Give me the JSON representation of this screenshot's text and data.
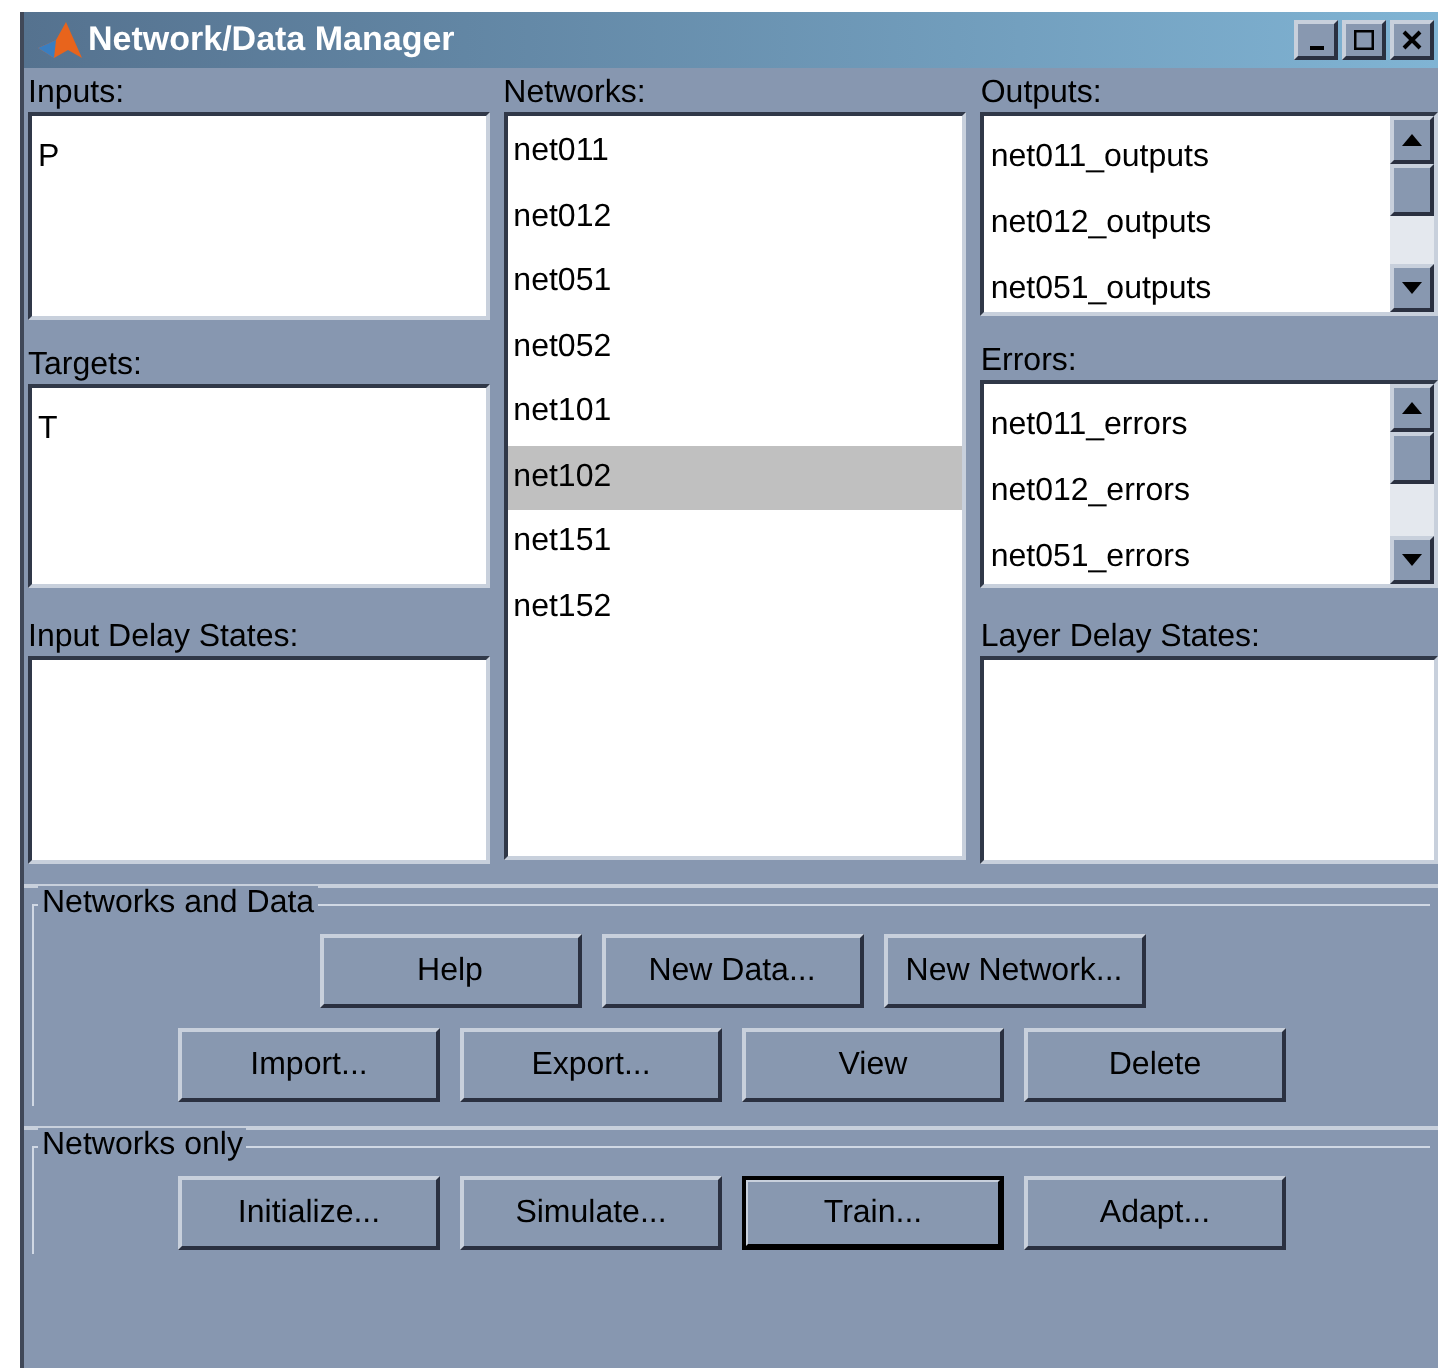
{
  "window": {
    "title": "Network/Data Manager"
  },
  "inputs": {
    "label": "Inputs:",
    "items": [
      "P"
    ]
  },
  "targets": {
    "label": "Targets:",
    "items": [
      "T"
    ]
  },
  "input_delay_states": {
    "label": "Input Delay States:"
  },
  "networks": {
    "label": "Networks:",
    "items": [
      {
        "name": "net011",
        "selected": false
      },
      {
        "name": "net012",
        "selected": false
      },
      {
        "name": "net051",
        "selected": false
      },
      {
        "name": "net052",
        "selected": false
      },
      {
        "name": "net101",
        "selected": false
      },
      {
        "name": "net102",
        "selected": true
      },
      {
        "name": "net151",
        "selected": false
      },
      {
        "name": "net152",
        "selected": false
      }
    ]
  },
  "outputs": {
    "label": "Outputs:",
    "items": [
      "net011_outputs",
      "net012_outputs",
      "net051_outputs"
    ]
  },
  "errors": {
    "label": "Errors:",
    "items": [
      "net011_errors",
      "net012_errors",
      "net051_errors"
    ]
  },
  "layer_delay_states": {
    "label": "Layer Delay States:"
  },
  "groups": [
    {
      "title": "Networks and Data",
      "rows": [
        [
          {
            "label": "Help",
            "focused": false
          },
          {
            "label": "New Data...",
            "focused": false
          },
          {
            "label": "New Network...",
            "focused": false
          }
        ],
        [
          {
            "label": "Import...",
            "focused": false
          },
          {
            "label": "Export...",
            "focused": false
          },
          {
            "label": "View",
            "focused": false
          },
          {
            "label": "Delete",
            "focused": false
          }
        ]
      ]
    },
    {
      "title": "Networks only",
      "rows": [
        [
          {
            "label": "Initialize...",
            "focused": false
          },
          {
            "label": "Simulate...",
            "focused": false
          },
          {
            "label": "Train...",
            "focused": true
          },
          {
            "label": "Adapt...",
            "focused": false
          }
        ]
      ]
    }
  ]
}
